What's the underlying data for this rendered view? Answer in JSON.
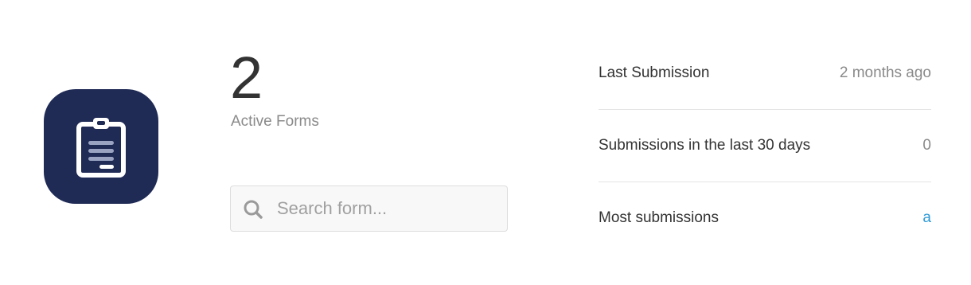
{
  "summary": {
    "active_forms_count": "2",
    "active_forms_label": "Active Forms"
  },
  "search": {
    "placeholder": "Search form...",
    "value": ""
  },
  "stats": [
    {
      "label": "Last Submission",
      "value": "2 months ago"
    },
    {
      "label": "Submissions in the last 30 days",
      "value": "0"
    },
    {
      "label": "Most submissions",
      "value": "a"
    }
  ],
  "colors": {
    "icon_background": "#1f2a55",
    "link": "#2d9ad6"
  },
  "icons": {
    "app_icon": "clipboard-icon",
    "search_icon": "search-icon"
  }
}
